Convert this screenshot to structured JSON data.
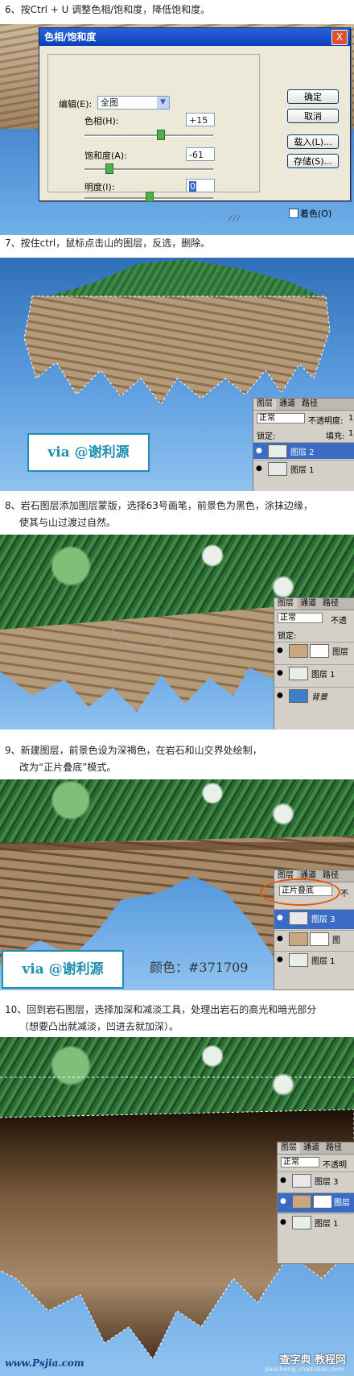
{
  "steps": [
    {
      "lines": [
        "6、按Ctrl + U 调整色相/饱和度，降低饱和度。"
      ]
    },
    {
      "lines": [
        "7、按住ctrl，鼠标点击山的图层，反选，删除。"
      ]
    },
    {
      "lines": [
        "8、岩石图层添加图层蒙版，选择63号画笔，前景色为黑色，涂抹边缘，",
        "使其与山过渡过自然。"
      ]
    },
    {
      "lines": [
        "9、新建图层，前景色设为深褐色，在岩石和山交界处绘制，",
        "改为“正片叠底”模式。"
      ]
    },
    {
      "lines": [
        "10、回到岩石图层，选择加深和减淡工具，处理出岩石的高光和暗光部分",
        "（想要凸出就减淡，凹进去就加深）。"
      ]
    }
  ],
  "dialog": {
    "title": "色相/饱和度",
    "close": "X",
    "edit_label": "编辑(E):",
    "edit_value": "全图",
    "hue_label": "色相(H):",
    "hue_value": "+15",
    "saturation_label": "饱和度(A):",
    "saturation_value": "-61",
    "lightness_label": "明度(I):",
    "lightness_value": "0",
    "ok": "确定",
    "cancel": "取消",
    "load": "载入(L)...",
    "save": "存储(S)...",
    "colorize": "着色(O)"
  },
  "panel7": {
    "tabs": [
      "图层",
      "通道",
      "路径"
    ],
    "mode": "正常",
    "opacity_label": "不透明度:",
    "opacity_value": "1",
    "lock_label": "锁定:",
    "fill_label": "填充:",
    "fill_value": "1",
    "layers": [
      "图层 2",
      "图层 1"
    ]
  },
  "panel8": {
    "tabs": [
      "图层",
      "通道",
      "路径"
    ],
    "mode": "正常",
    "opacity_label": "不透",
    "lock_label": "锁定:",
    "layers": [
      "图层",
      "图层 1",
      "背景"
    ]
  },
  "panel9": {
    "tabs": [
      "图层",
      "通道",
      "路径"
    ],
    "mode": "正片叠底",
    "opacity_label": "不",
    "layers": [
      "图层 3",
      "图",
      "图层 1"
    ]
  },
  "panel10": {
    "tabs": [
      "图层",
      "通道",
      "路径"
    ],
    "mode": "正常",
    "opacity_label": "不透明",
    "layers": [
      "图层 3",
      "图层",
      "图层 1"
    ]
  },
  "watermark": "via @谢利源",
  "color_note": "颜色：#371709",
  "footer": {
    "left": "www.Psjia.com",
    "right": "查字典 教程网",
    "url": "jiaocheng.chazidian.com"
  }
}
